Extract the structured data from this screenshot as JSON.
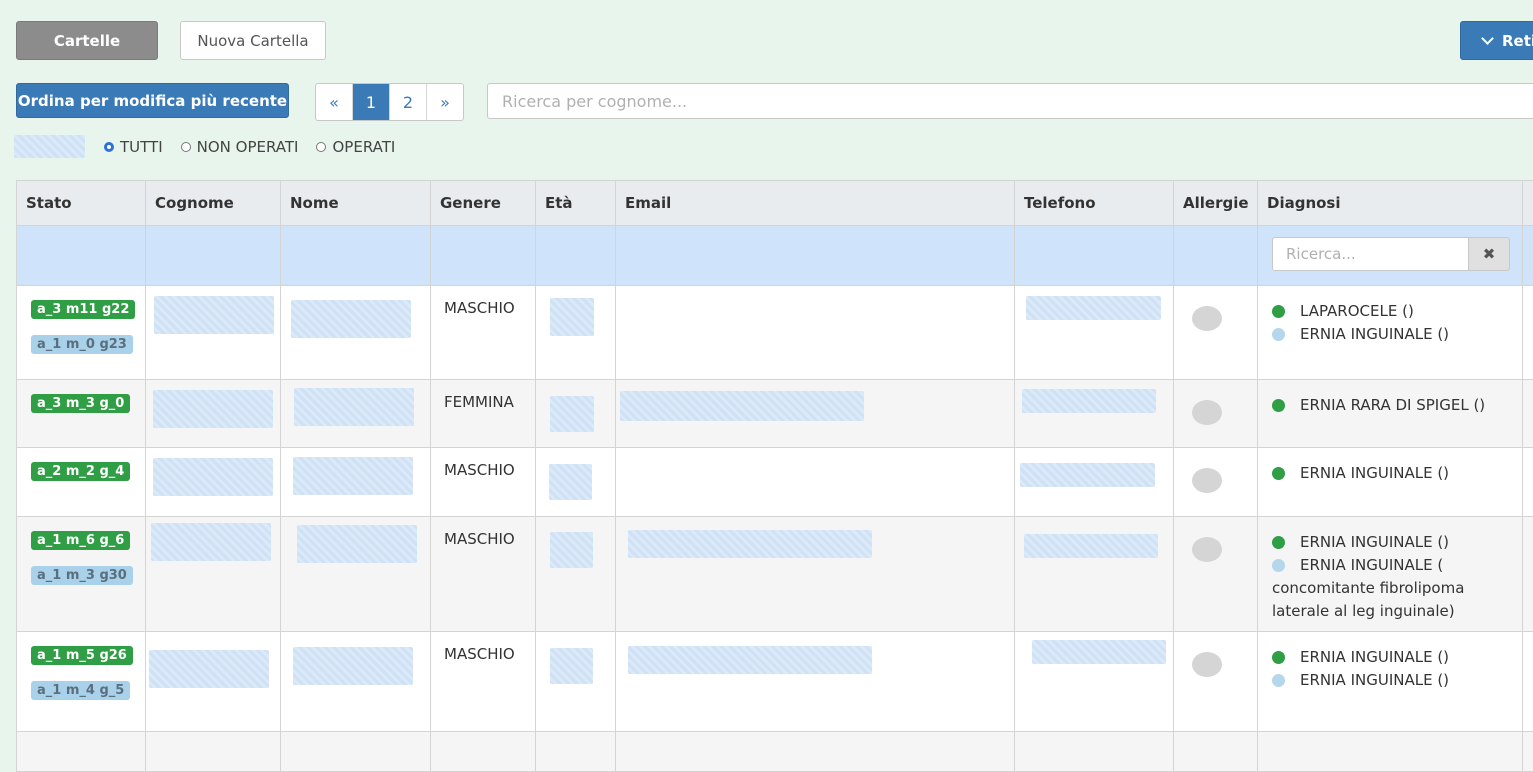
{
  "toolbar": {
    "cartelle_label": "Cartelle",
    "nuova_cartella_label": "Nuova Cartella",
    "right_button_label": "Reti",
    "sort_label": "Ordina per modifica più recente"
  },
  "pagination": {
    "prev": "«",
    "pages": [
      "1",
      "2"
    ],
    "next": "»",
    "active": "1"
  },
  "search": {
    "placeholder": "Ricerca per cognome..."
  },
  "filters": {
    "options": [
      "TUTTI",
      "NON OPERATI",
      "OPERATI"
    ],
    "selected": "TUTTI"
  },
  "table": {
    "headers": [
      "Stato",
      "Cognome",
      "Nome",
      "Genere",
      "Età",
      "Email",
      "Telefono",
      "Allergie",
      "Diagnosi"
    ],
    "diagnosi_search_placeholder": "Ricerca...",
    "clear_icon": "✖",
    "rows": [
      {
        "badges": [
          "a_3 m11 g22",
          "a_1 m_0 g23"
        ],
        "genere": "MASCHIO",
        "diagnosi": [
          {
            "color": "green",
            "text": "LAPAROCELE ()"
          },
          {
            "color": "blue",
            "text": "ERNIA INGUINALE ()"
          }
        ]
      },
      {
        "badges": [
          "a_3 m_3 g_0"
        ],
        "genere": "FEMMINA",
        "diagnosi": [
          {
            "color": "green",
            "text": "ERNIA RARA DI SPIGEL ()"
          }
        ]
      },
      {
        "badges": [
          "a_2 m_2 g_4"
        ],
        "genere": "MASCHIO",
        "diagnosi": [
          {
            "color": "green",
            "text": "ERNIA INGUINALE ()"
          }
        ]
      },
      {
        "badges": [
          "a_1 m_6 g_6",
          "a_1 m_3 g30"
        ],
        "genere": "MASCHIO",
        "diagnosi": [
          {
            "color": "green",
            "text": "ERNIA INGUINALE ()"
          },
          {
            "color": "blue",
            "text": "ERNIA INGUINALE ("
          }
        ],
        "diagnosi_extra": "concomitante fibrolipoma laterale al leg inguinale)"
      },
      {
        "badges": [
          "a_1 m_5 g26",
          "a_1 m_4 g_5"
        ],
        "genere": "MASCHIO",
        "diagnosi": [
          {
            "color": "green",
            "text": "ERNIA INGUINALE ()"
          },
          {
            "color": "blue",
            "text": "ERNIA INGUINALE ()"
          }
        ]
      }
    ]
  },
  "colors": {
    "background": "#e8f5ec",
    "primary": "#3a7ab7",
    "badge_green": "#2f9e44",
    "badge_blue": "#a9d2ea"
  }
}
